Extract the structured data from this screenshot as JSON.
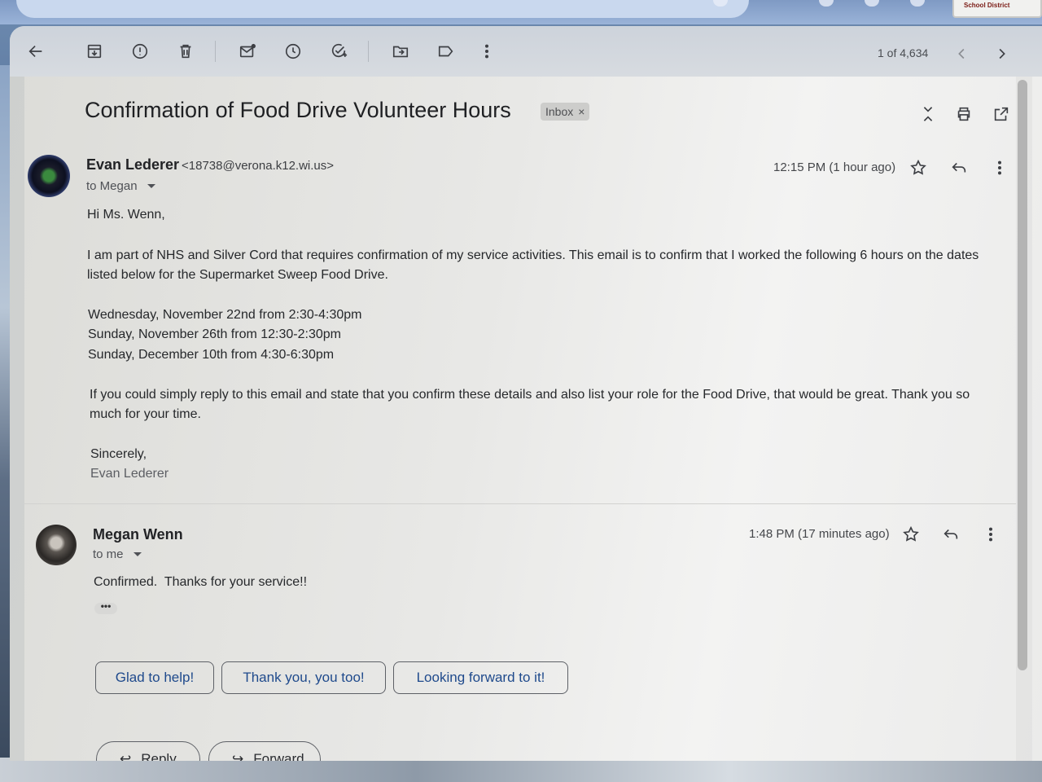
{
  "toolbar": {
    "counter": "1 of 4,634",
    "icons": [
      "back-arrow-icon",
      "archive-icon",
      "report-spam-icon",
      "trash-icon",
      "mark-unread-icon",
      "snooze-icon",
      "add-task-icon",
      "move-to-icon",
      "label-icon",
      "more-vert-icon",
      "chevron-left-icon",
      "chevron-right-icon"
    ]
  },
  "top_logo": "School District",
  "thread": {
    "subject": "Confirmation of Food Drive Volunteer Hours",
    "label": "Inbox",
    "label_close": "×"
  },
  "message1": {
    "sender_name": "Evan Lederer",
    "sender_email": "<18738@verona.k12.wi.us>",
    "to": "to Megan",
    "timestamp": "12:15 PM (1 hour ago)",
    "greeting": "Hi Ms. Wenn,",
    "para1_line1": "I am part of NHS and Silver Cord that requires confirmation of my service activities. This email is to confirm that I worked the following 6 hours on the dates",
    "para1_line2": "listed below for the Supermarket Sweep Food Drive.",
    "date1": "Wednesday, November 22nd from 2:30-4:30pm",
    "date2": "Sunday, November 26th from 12:30-2:30pm",
    "date3": "Sunday, December 10th from 4:30-6:30pm",
    "para2_line1": "If you could simply reply to this email and state that you confirm these details and also list your role for the Food Drive, that would be great. Thank you so",
    "para2_line2": "much for your time.",
    "closing": "Sincerely,",
    "signature": "Evan Lederer"
  },
  "message2": {
    "sender_name": "Megan Wenn",
    "to": "to me",
    "timestamp": "1:48 PM (17 minutes ago)",
    "body": "Confirmed.  Thanks for your service!!",
    "trimmed": "•••"
  },
  "smart_replies": [
    "Glad to help!",
    "Thank you, you too!",
    "Looking forward to it!"
  ],
  "actions": {
    "reply": "Reply",
    "forward": "Forward"
  }
}
